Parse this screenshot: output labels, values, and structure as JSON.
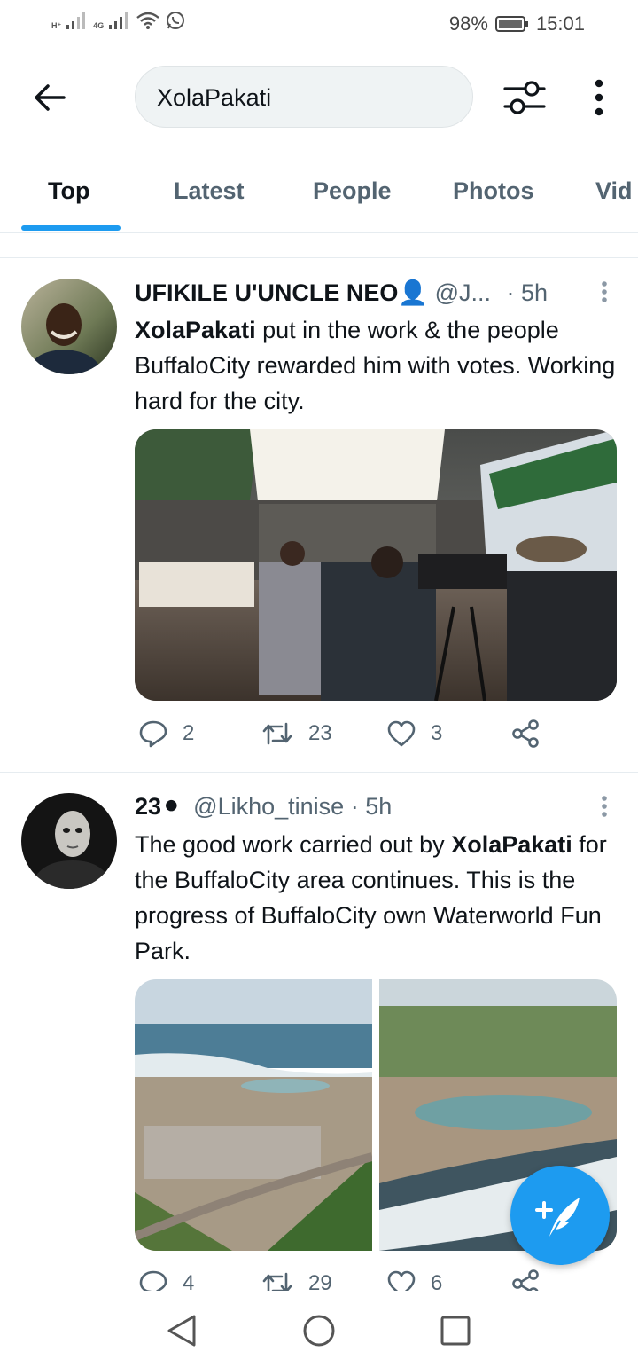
{
  "status_bar": {
    "network_1": "H⁺",
    "network_2": "4G",
    "battery": "98%",
    "time": "15:01"
  },
  "search": {
    "query": "XolaPakati"
  },
  "tabs": [
    {
      "label": "Top",
      "active": true
    },
    {
      "label": "Latest",
      "active": false
    },
    {
      "label": "People",
      "active": false
    },
    {
      "label": "Photos",
      "active": false
    },
    {
      "label": "Vid",
      "active": false
    }
  ],
  "tweets": [
    {
      "name": "UFIKILE U'UNCLE NEO👤",
      "handle": "@J...",
      "time": "· 5h",
      "text_bold": "XolaPakati",
      "text_rest": " put in the work & the people BuffaloCity rewarded him with votes. Working hard for the city.",
      "replies": "2",
      "retweets": "23",
      "likes": "3"
    },
    {
      "name": "23⚫",
      "handle": "@Likho_tinise",
      "time": "· 5h",
      "text_pre": "The good work carried out by ",
      "text_bold": "XolaPakati",
      "text_rest": " for the BuffaloCity area continues.  This is the progress of BuffaloCity own Waterworld Fun Park.",
      "replies": "4",
      "retweets": "29",
      "likes": "6"
    }
  ],
  "icons": {
    "back": "back-arrow-icon",
    "filter": "filter-sliders-icon",
    "more": "more-vertical-icon",
    "reply": "reply-icon",
    "retweet": "retweet-icon",
    "like": "heart-icon",
    "share": "share-icon",
    "compose": "compose-feather-icon"
  },
  "colors": {
    "accent": "#1d9bf0",
    "text": "#0f1419",
    "secondary": "#536471"
  }
}
